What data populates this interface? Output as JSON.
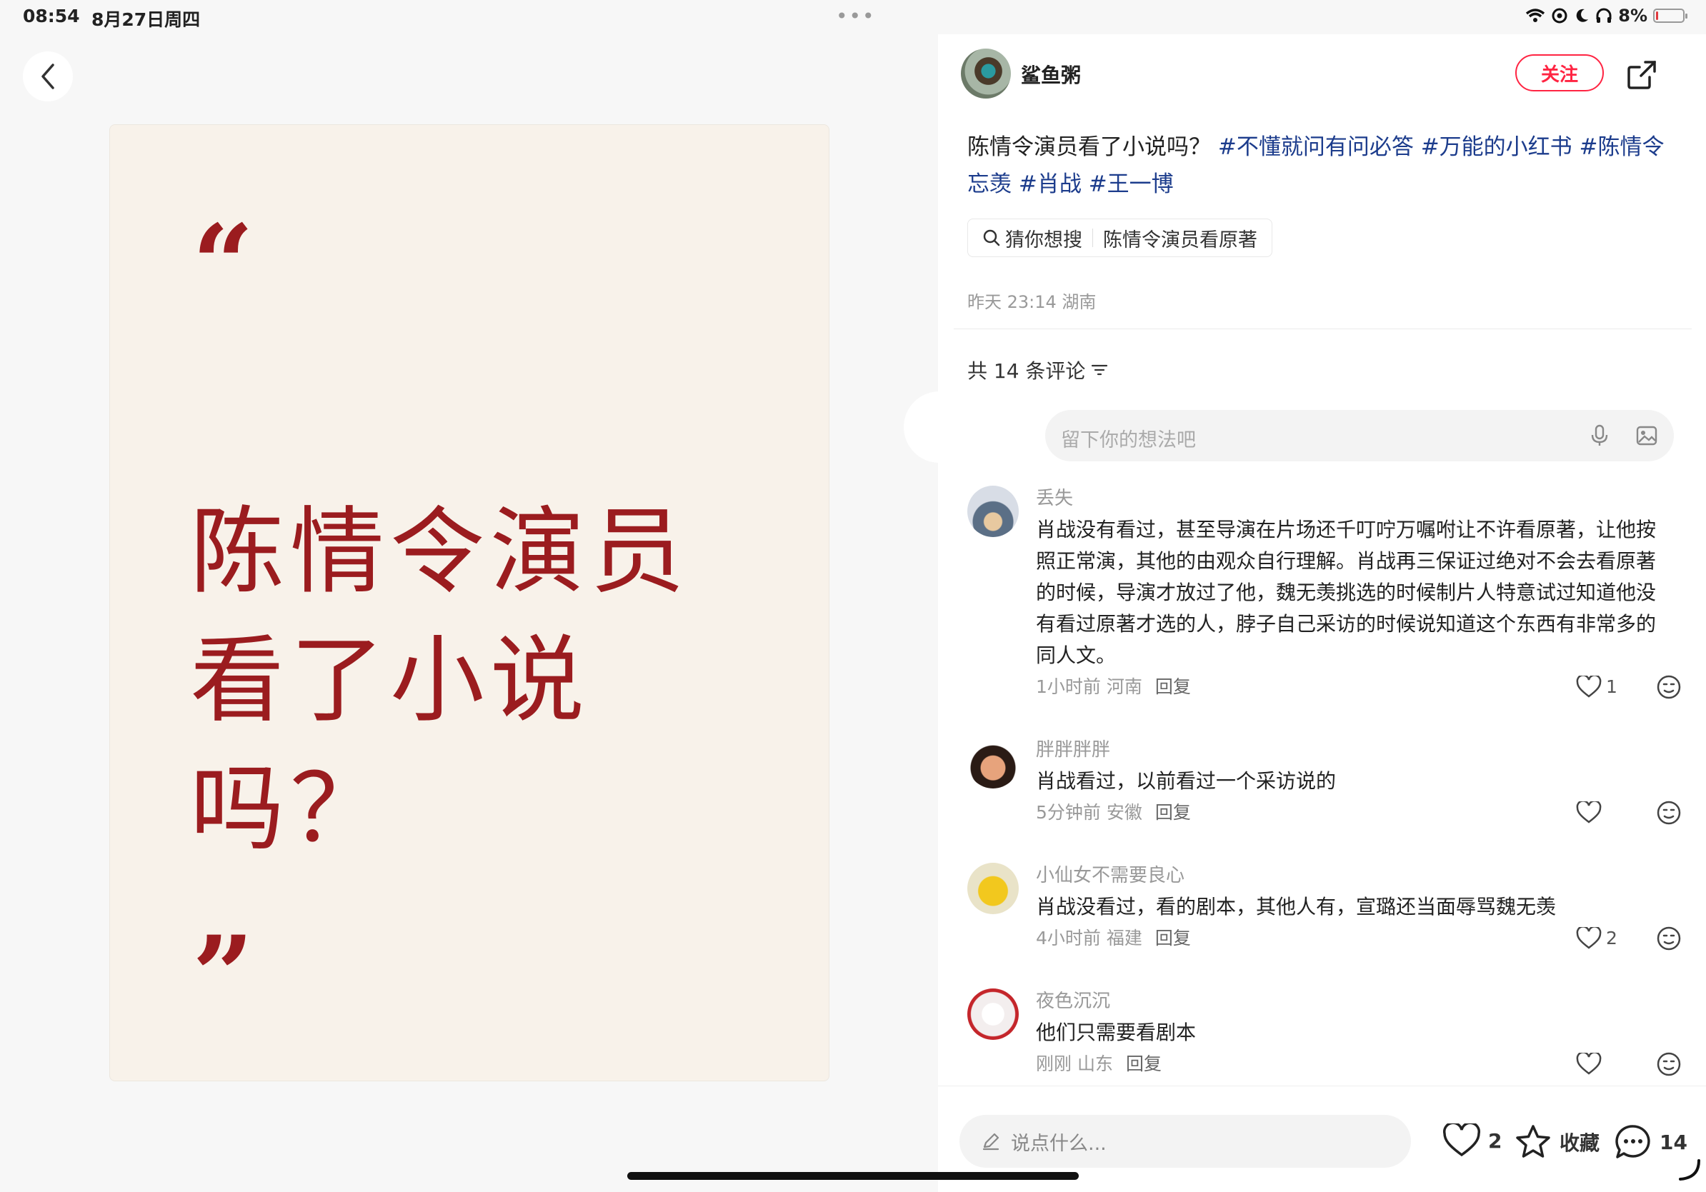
{
  "status_bar": {
    "time": "08:54",
    "date": "8月27日周四",
    "dots": "•••",
    "battery": "8%",
    "battery_level": 0.08
  },
  "left": {
    "quote_open": "“",
    "quote_close": "”",
    "card_title": "陈情令演员看了小说吗？",
    "card_color": "#9b1c1f"
  },
  "author": {
    "name": "鲨鱼粥",
    "follow_label": "关注"
  },
  "post": {
    "text": "陈情令演员看了小说吗？",
    "tags": [
      "#不懂就问有问必答",
      "#万能的小红书",
      "#陈情令忘羡",
      "#肖战",
      "#王一博"
    ],
    "search_suggest_label": "猜你想搜",
    "search_suggest_value": "陈情令演员看原著",
    "meta": "昨天 23:14 湖南"
  },
  "comments_section": {
    "count_text": "共 14 条评论",
    "input_placeholder": "留下你的想法吧",
    "items": [
      {
        "name": "丢失",
        "text": "肖战没有看过，甚至导演在片场还千叮咛万嘱咐让不许看原著，让他按照正常演，其他的由观众自行理解。肖战再三保证过绝对不会去看原著的时候，导演才放过了他，魏无羡挑选的时候制片人特意试过知道他没有看过原著才选的人，脖子自己采访的时候说知道这个东西有非常多的同人文。",
        "time": "1小时前 河南",
        "reply": "回复",
        "likes": "1"
      },
      {
        "name": "胖胖胖胖",
        "text": "肖战看过，以前看过一个采访说的",
        "time": "5分钟前 安徽",
        "reply": "回复",
        "likes": ""
      },
      {
        "name": "小仙女不需要良心",
        "text": "肖战没看过，看的剧本，其他人有，宣璐还当面辱骂魏无羡",
        "time": "4小时前 福建",
        "reply": "回复",
        "likes": "2"
      },
      {
        "name": "夜色沉沉",
        "text": "他们只需要看剧本",
        "time": "刚刚 山东",
        "reply": "回复",
        "likes": ""
      }
    ]
  },
  "bottom_bar": {
    "say_placeholder": "说点什么...",
    "likes": "2",
    "collect_label": "收藏",
    "comments": "14"
  },
  "colors": {
    "accent": "#ff2442",
    "tag": "#1c3c8c",
    "card_bg": "#f8f2ea"
  },
  "icons": [
    "back-chevron-icon",
    "share-icon",
    "search-icon",
    "filter-icon",
    "mic-icon",
    "image-icon",
    "heart-icon",
    "emoji-icon",
    "edit-icon",
    "star-icon",
    "chat-icon",
    "wifi-icon",
    "at-icon",
    "moon-icon",
    "headphones-icon",
    "battery-icon"
  ]
}
